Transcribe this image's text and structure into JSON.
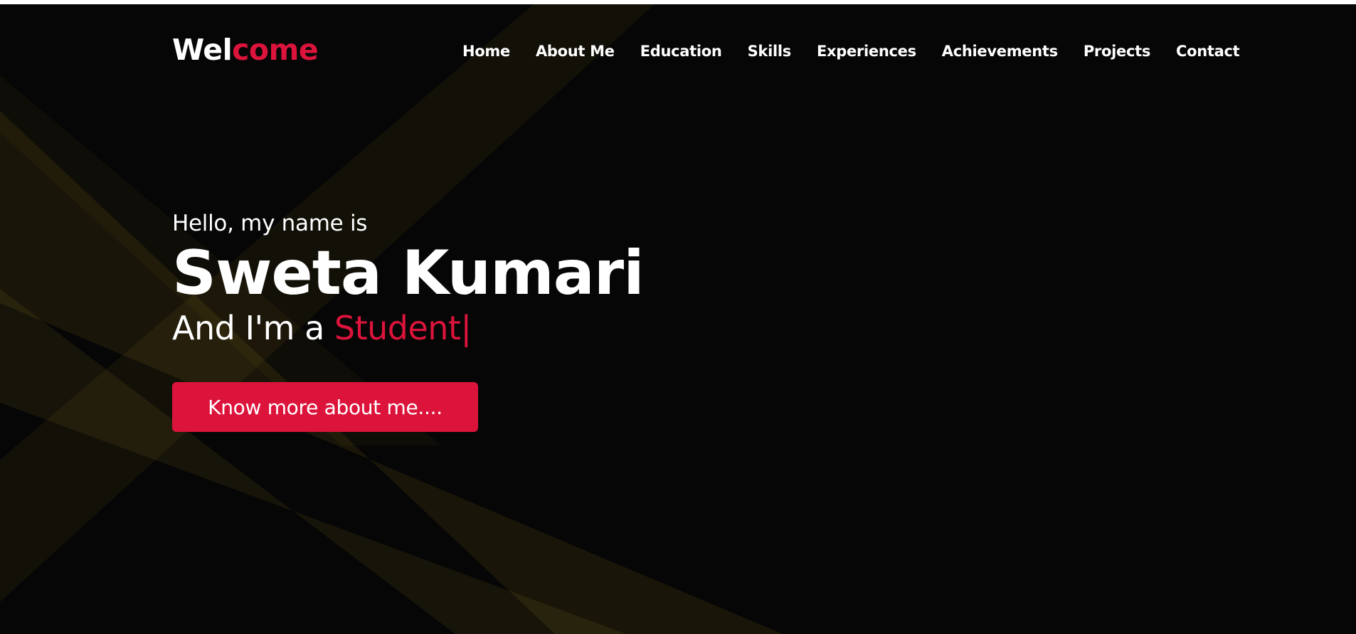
{
  "logo": {
    "part1": "Wel",
    "part2": "come"
  },
  "nav": {
    "items": [
      {
        "label": "Home"
      },
      {
        "label": "About Me"
      },
      {
        "label": "Education"
      },
      {
        "label": "Skills"
      },
      {
        "label": "Experiences"
      },
      {
        "label": "Achievements"
      },
      {
        "label": "Projects"
      },
      {
        "label": "Contact"
      }
    ]
  },
  "hero": {
    "greeting": "Hello, my name is",
    "name": "Sweta Kumari",
    "role_prefix": "And I'm a ",
    "role_typed": "Student",
    "cursor": "|",
    "cta_label": "Know more about me...."
  },
  "colors": {
    "accent": "#dc143c",
    "background": "#060606",
    "text": "#ffffff",
    "beam": "#c9a227"
  }
}
